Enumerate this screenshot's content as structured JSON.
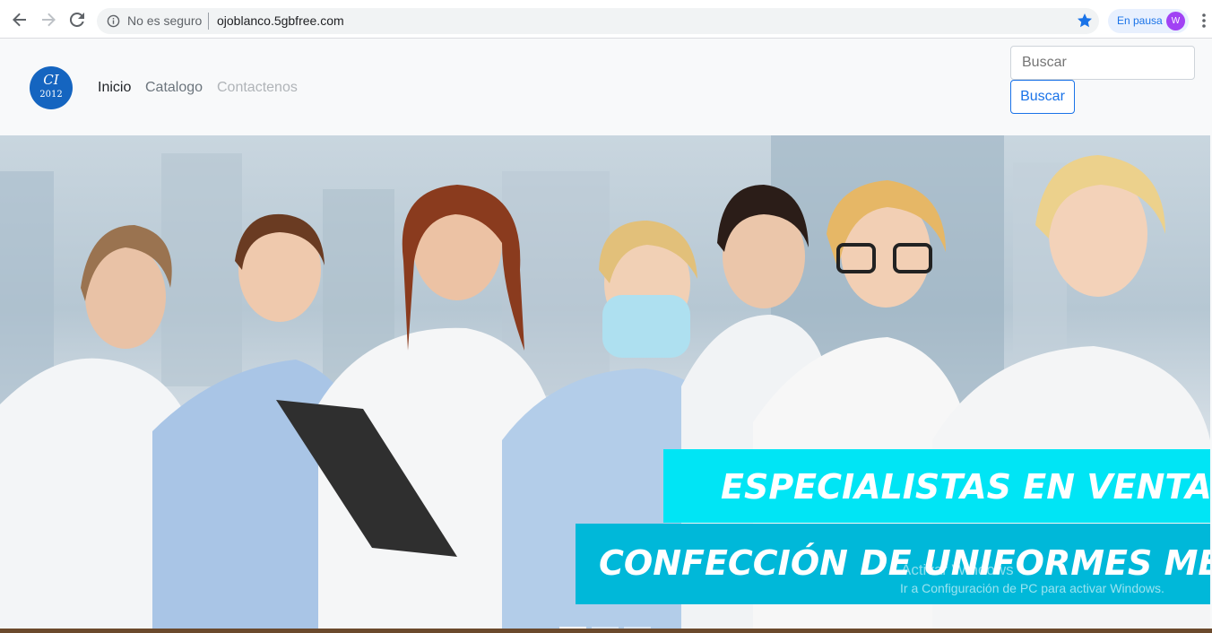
{
  "browser": {
    "security_label": "No es seguro",
    "url": "ojoblanco.5gbfree.com",
    "profile_label": "En pausa",
    "avatar_initial": "W"
  },
  "site": {
    "logo": {
      "top": "CI",
      "bottom": "2012"
    },
    "nav": [
      "Inicio",
      "Catalogo",
      "Contactenos"
    ],
    "search": {
      "placeholder": "Buscar",
      "button": "Buscar"
    }
  },
  "hero": {
    "line1": "ESPECIALISTAS EN VENTA Y",
    "line2": "CONFECCIÓN DE UNIFORMES MÉDICOS",
    "carousel_slides": 3,
    "active_slide": 1
  },
  "os_watermark": {
    "title": "Activar Windows",
    "subtitle": "Ir a Configuración de PC para activar Windows."
  },
  "colors": {
    "accent": "#1a73e8",
    "banner_light": "#00e5f5",
    "banner_dark": "#00b8d9",
    "logo": "#1565c0"
  }
}
